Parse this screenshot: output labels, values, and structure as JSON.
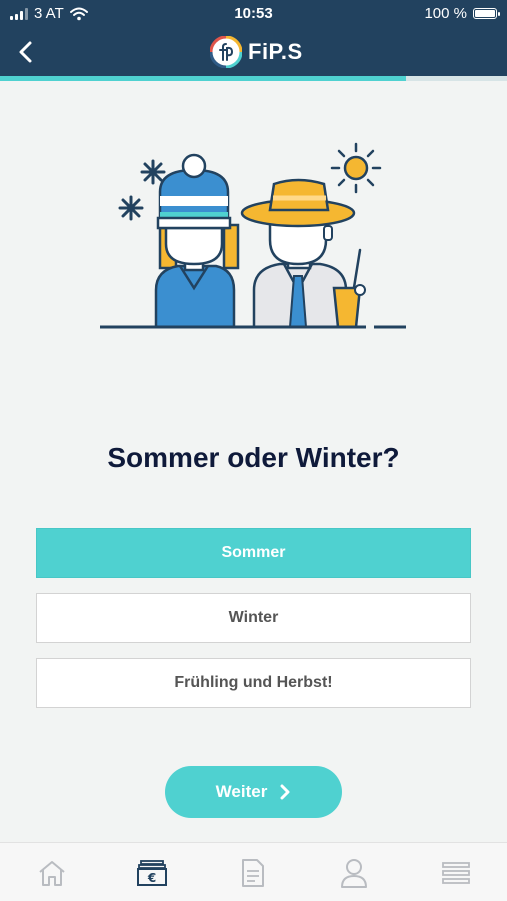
{
  "status_bar": {
    "carrier": "3 AT",
    "time": "10:53",
    "battery": "100 %"
  },
  "header": {
    "app_name": "FiP.S",
    "back_icon": "chevron-left-icon",
    "logo": "fips-logo"
  },
  "progress": {
    "fraction": 0.8
  },
  "main": {
    "question": "Sommer oder Winter?",
    "options": [
      {
        "label": "Sommer",
        "selected": true
      },
      {
        "label": "Winter",
        "selected": false
      },
      {
        "label": "Frühling und Herbst!",
        "selected": false
      }
    ],
    "next_button": "Weiter"
  },
  "tabbar": {
    "items": [
      {
        "icon": "home-icon",
        "active": false
      },
      {
        "icon": "euro-wallet-icon",
        "active": true
      },
      {
        "icon": "document-icon",
        "active": false
      },
      {
        "icon": "user-icon",
        "active": false
      },
      {
        "icon": "menu-icon",
        "active": false
      }
    ]
  },
  "colors": {
    "header": "#22425f",
    "accent": "#4fd1d0",
    "text_dark": "#0f1a3a"
  }
}
